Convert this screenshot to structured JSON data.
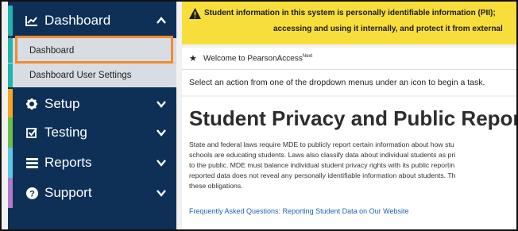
{
  "sidebar": {
    "dashboard": {
      "label": "Dashboard",
      "stripe": "#1fb5ae"
    },
    "sub_items": [
      {
        "label": "Dashboard"
      },
      {
        "label": "Dashboard User Settings"
      }
    ],
    "setup": {
      "label": "Setup",
      "stripe": "#f5a623"
    },
    "testing": {
      "label": "Testing",
      "stripe": "#6cc04a"
    },
    "reports": {
      "label": "Reports",
      "stripe": "#5bc8e8"
    },
    "support": {
      "label": "Support",
      "stripe": "#b07cc6"
    }
  },
  "banner": {
    "line1": "Student information in this system is personally identifiable information (PII);",
    "line2": "accessing and using it internally, and protect it from external"
  },
  "welcome": {
    "text": "Welcome to PearsonAccess",
    "sup": "Next"
  },
  "instruction": "Select an action from one of the dropdown menus under an icon to begin a task.",
  "content": {
    "title": "Student Privacy and Public Reports",
    "paragraph": [
      "State and federal laws require MDE to publicly report certain information about how stu",
      "schools are educating students. Laws also classify data about individual students as pri",
      "to the public. MDE must balance individual student privacy rights with its public reportin",
      "reported data does not reveal any personally identifiable information about students. Th",
      "these obligations."
    ],
    "link": "Frequently Asked Questions: Reporting Student Data on Our Website"
  },
  "colors": {
    "sidebar_bg": "#0e3057",
    "banner_bg": "#f7de3a",
    "highlight": "#f08a2e",
    "link": "#1f62b4"
  },
  "icons": [
    "dashboard-chart-icon",
    "chevron-up-icon",
    "gear-icon",
    "checkbox-icon",
    "reports-icon",
    "help-icon",
    "chevron-down-icon",
    "warning-icon",
    "star-icon"
  ]
}
